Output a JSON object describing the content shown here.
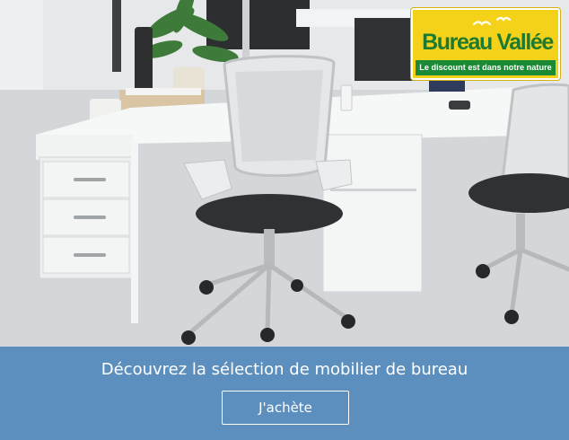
{
  "ad": {
    "headline": "Découvrez la sélection de mobilier de bureau",
    "cta_label": "J'achète"
  },
  "logo": {
    "name": "Bureau Vallée",
    "tagline": "Le discount est dans notre nature"
  },
  "colors": {
    "band": "#5c8fbd",
    "logo_yellow": "#f5d21a",
    "logo_green": "#1a8a35",
    "logo_text_green": "#1d7a30"
  }
}
